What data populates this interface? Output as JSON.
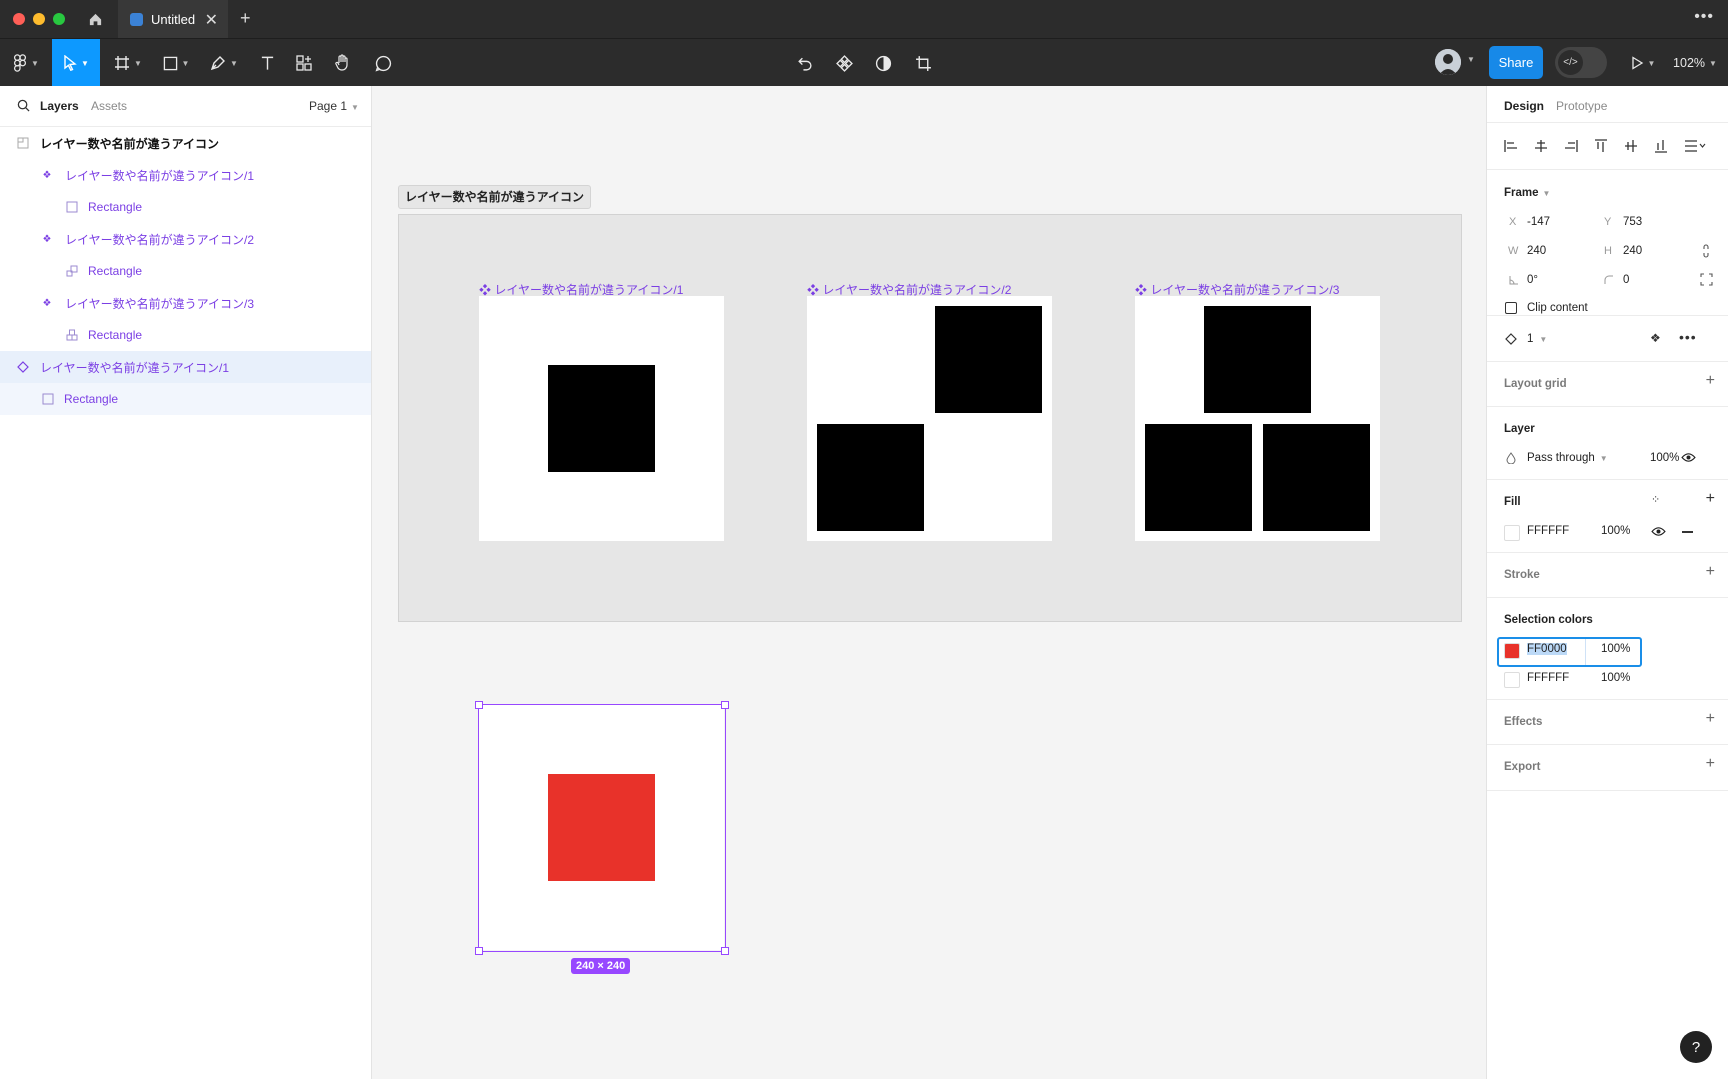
{
  "titlebar": {
    "home_icon": "home-icon",
    "tab_title": "Untitled",
    "tab_close": "✕",
    "new_tab": "+",
    "menu": "•••"
  },
  "toolbar": {
    "share_label": "Share",
    "zoom_label": "102%",
    "devmode_label": "</>"
  },
  "left_panel": {
    "tab_layers": "Layers",
    "tab_assets": "Assets",
    "page_selector": "Page 1",
    "layers": [
      {
        "label": "レイヤー数や名前が違うアイコン",
        "icon": "frame-icon",
        "indent": 0,
        "style": "bold"
      },
      {
        "label": "レイヤー数や名前が違うアイコン/1",
        "icon": "component-icon",
        "indent": 1,
        "style": "purple"
      },
      {
        "label": "Rectangle",
        "icon": "rectangle-icon",
        "indent": 2,
        "style": "purple"
      },
      {
        "label": "レイヤー数や名前が違うアイコン/2",
        "icon": "component-icon",
        "indent": 1,
        "style": "purple"
      },
      {
        "label": "Rectangle",
        "icon": "rectangle-group-icon",
        "indent": 2,
        "style": "purple"
      },
      {
        "label": "レイヤー数や名前が違うアイコン/3",
        "icon": "component-icon",
        "indent": 1,
        "style": "purple"
      },
      {
        "label": "Rectangle",
        "icon": "rectangle-group-icon",
        "indent": 2,
        "style": "purple"
      },
      {
        "label": "レイヤー数や名前が違うアイコン/1",
        "icon": "instance-icon",
        "indent": 0,
        "style": "purple-selected"
      },
      {
        "label": "Rectangle",
        "icon": "rectangle-icon",
        "indent": 1,
        "style": "purple-child-selected"
      }
    ]
  },
  "canvas": {
    "frame_label": "レイヤー数や名前が違うアイコン",
    "component_1_label": "レイヤー数や名前が違うアイコン/1",
    "component_2_label": "レイヤー数や名前が違うアイコン/2",
    "component_3_label": "レイヤー数や名前が違うアイコン/3",
    "selection_size": "240 × 240",
    "instance_fill": "#e8322a"
  },
  "right_panel": {
    "tab_design": "Design",
    "tab_prototype": "Prototype",
    "frame": {
      "title": "Frame",
      "x_label": "X",
      "x": "-147",
      "y_label": "Y",
      "y": "753",
      "w_label": "W",
      "w": "240",
      "h_label": "H",
      "h": "240",
      "rotation": "0°",
      "radius": "0",
      "clip_content": "Clip content"
    },
    "instance": {
      "value": "1"
    },
    "layout_grid": {
      "title": "Layout grid"
    },
    "layer": {
      "title": "Layer",
      "blend": "Pass through",
      "opacity": "100%"
    },
    "fill": {
      "title": "Fill",
      "hex": "FFFFFF",
      "opacity": "100%"
    },
    "stroke": {
      "title": "Stroke"
    },
    "selection_colors": {
      "title": "Selection colors",
      "colors": [
        {
          "hex": "FF0000",
          "opacity": "100%",
          "swatch": "#e8322a"
        },
        {
          "hex": "FFFFFF",
          "opacity": "100%",
          "swatch": "#ffffff"
        }
      ]
    },
    "effects": {
      "title": "Effects"
    },
    "export": {
      "title": "Export"
    }
  },
  "help": "?"
}
